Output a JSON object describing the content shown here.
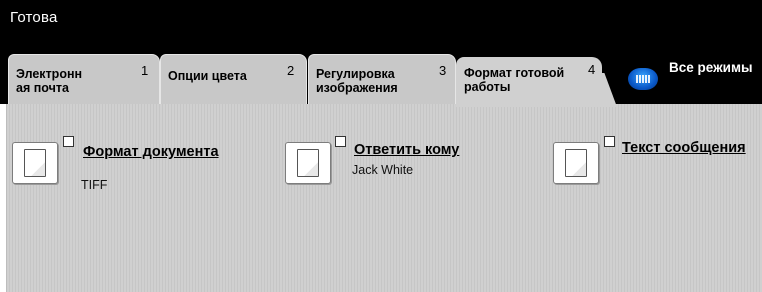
{
  "status": "Готова",
  "tabs": [
    {
      "label_line1": "Электронн",
      "label_line2": "ая почта",
      "number": "1"
    },
    {
      "label_line1": "Опции цвета",
      "label_line2": "",
      "number": "2"
    },
    {
      "label_line1": "Регулировка",
      "label_line2": "изображения",
      "number": "3"
    },
    {
      "label_line1": "Формат готовой",
      "label_line2": "работы",
      "number": "4"
    }
  ],
  "all_services": {
    "label": "Все режимы",
    "icon": "all-services-icon"
  },
  "features": [
    {
      "title": "Формат документа",
      "value": "TIFF",
      "icon": "document-icon"
    },
    {
      "title": "Ответить кому",
      "value": "Jack White",
      "icon": "document-icon"
    },
    {
      "title": "Текст сообщения",
      "value": "",
      "icon": "document-icon"
    }
  ],
  "colors": {
    "header": "#000000",
    "tab": "#c8c8c8",
    "panel": "#cccccc",
    "accent": "#0a58c8"
  }
}
